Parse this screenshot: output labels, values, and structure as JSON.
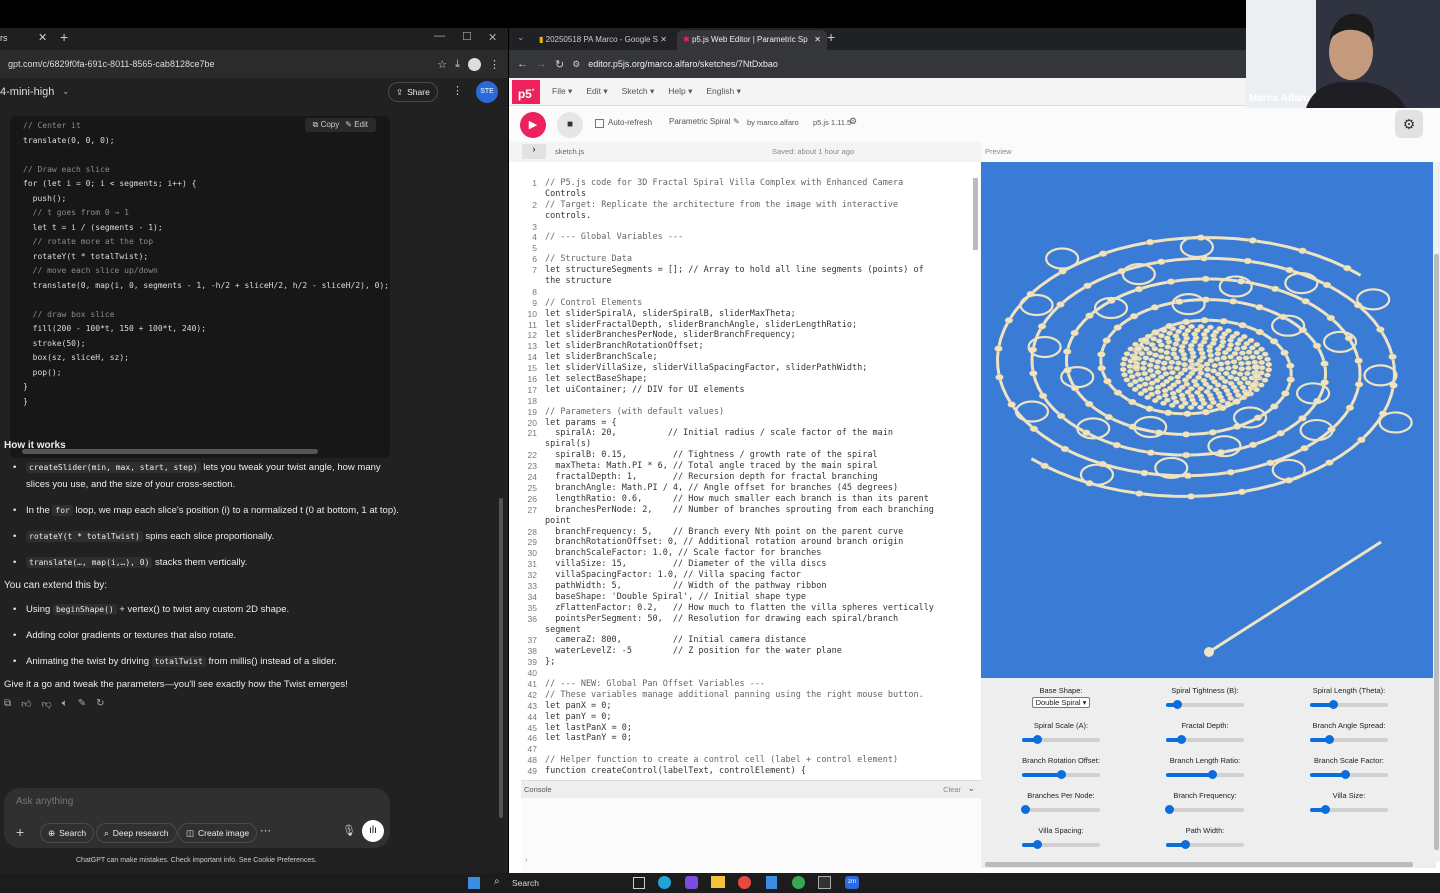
{
  "left": {
    "tab_title": "rs",
    "url": "gpt.com/c/6829f0fa-691c-8011-8565-cab8128ce7be",
    "model": "4-mini-high",
    "share_label": "Share",
    "avatar_text": "STE",
    "copy_label": "Copy",
    "edit_label": "Edit",
    "code_lines": [
      "// Center it",
      "translate(0, 0, 0);",
      "",
      "// Draw each slice",
      "for (let i = 0; i < segments; i++) {",
      "  push();",
      "  // t goes from 0 → 1",
      "  let t = i / (segments - 1);",
      "  // rotate more at the top",
      "  rotateY(t * totalTwist);",
      "  // move each slice up/down",
      "  translate(0, map(i, 0, segments - 1, -h/2 + sliceH/2, h/2 - sliceH/2), 0);",
      "",
      "  // draw box slice",
      "  fill(200 - 100*t, 150 + 100*t, 240);",
      "  stroke(50);",
      "  box(sz, sliceH, sz);",
      "  pop();",
      "}",
      "}"
    ],
    "how_heading": "How it works",
    "how_bullets": [
      {
        "code": "createSlider(min, max, start, step)",
        "text": " lets you tweak your twist angle, how many slices you use, and the size of your cross-section."
      },
      {
        "pre": "In the ",
        "code": "for",
        "text": " loop, we map each slice's position (i) to a normalized t (0 at bottom, 1 at top)."
      },
      {
        "code": "rotateY(t * totalTwist)",
        "text": " spins each slice proportionally."
      },
      {
        "code": "translate(…, map(i,…), 0)",
        "text": " stacks them vertically."
      }
    ],
    "extend_heading": "You can extend this by:",
    "extend_bullets": [
      {
        "pre": "Using ",
        "code": "beginShape()",
        "text": " + vertex() to twist any custom 2D shape."
      },
      {
        "pre": "",
        "code": "",
        "text": "Adding color gradients or textures that also rotate."
      },
      {
        "pre": "Animating the twist by driving ",
        "code": "totalTwist",
        "text": " from millis() instead of a slider."
      }
    ],
    "closing": "Give it a go and tweak the parameters—you'll see exactly how the Twist emerges!",
    "composer_placeholder": "Ask anything",
    "composer_buttons": [
      "Search",
      "Deep research",
      "Create image"
    ],
    "disclaimer": "ChatGPT can make mistakes. Check important info. See Cookie Preferences."
  },
  "right": {
    "tabs": [
      "20250518 PA Marco - Google S",
      "p5.js Web Editor | Parametric Sp"
    ],
    "url": "editor.p5js.org/marco.alfaro/sketches/7NtDxbao",
    "menu": [
      "File",
      "Edit",
      "Sketch",
      "Help",
      "English"
    ],
    "auto_refresh": "Auto-refresh",
    "sketch_name": "Parametric Spiral",
    "by": "by marco.alfaro",
    "version": "p5.js 1.11.5",
    "file_name": "sketch.js",
    "saved": "Saved: about 1 hour ago",
    "preview_label": "Preview",
    "console_label": "Console",
    "clear_label": "Clear",
    "code": [
      [
        "1",
        "// P5.js code for 3D Fractal Spiral Villa Complex with Enhanced Camera"
      ],
      [
        "",
        "Controls"
      ],
      [
        "2",
        "// Target: Replicate the architecture from the image with interactive"
      ],
      [
        "",
        "controls."
      ],
      [
        "3",
        ""
      ],
      [
        "4",
        "// --- Global Variables ---"
      ],
      [
        "5",
        ""
      ],
      [
        "6",
        "// Structure Data"
      ],
      [
        "7",
        "let structureSegments = []; // Array to hold all line segments (points) of"
      ],
      [
        "",
        "the structure"
      ],
      [
        "8",
        ""
      ],
      [
        "9",
        "// Control Elements"
      ],
      [
        "10",
        "let sliderSpiralA, sliderSpiralB, sliderMaxTheta;"
      ],
      [
        "11",
        "let sliderFractalDepth, sliderBranchAngle, sliderLengthRatio;"
      ],
      [
        "12",
        "let sliderBranchesPerNode, sliderBranchFrequency;"
      ],
      [
        "13",
        "let sliderBranchRotationOffset;"
      ],
      [
        "14",
        "let sliderBranchScale;"
      ],
      [
        "15",
        "let sliderVillaSize, sliderVillaSpacingFactor, sliderPathWidth;"
      ],
      [
        "16",
        "let selectBaseShape;"
      ],
      [
        "17",
        "let uiContainer; // DIV for UI elements"
      ],
      [
        "18",
        ""
      ],
      [
        "19",
        "// Parameters (with default values)"
      ],
      [
        "20",
        "let params = {"
      ],
      [
        "21",
        "  spiralA: 20,          // Initial radius / scale factor of the main"
      ],
      [
        "",
        "spiral(s)"
      ],
      [
        "22",
        "  spiralB: 0.15,         // Tightness / growth rate of the spiral"
      ],
      [
        "23",
        "  maxTheta: Math.PI * 6, // Total angle traced by the main spiral"
      ],
      [
        "24",
        "  fractalDepth: 1,       // Recursion depth for fractal branching"
      ],
      [
        "25",
        "  branchAngle: Math.PI / 4, // Angle offset for branches (45 degrees)"
      ],
      [
        "26",
        "  lengthRatio: 0.6,      // How much smaller each branch is than its parent"
      ],
      [
        "27",
        "  branchesPerNode: 2,    // Number of branches sprouting from each branching"
      ],
      [
        "",
        "point"
      ],
      [
        "28",
        "  branchFrequency: 5,    // Branch every Nth point on the parent curve"
      ],
      [
        "29",
        "  branchRotationOffset: 0, // Additional rotation around branch origin"
      ],
      [
        "30",
        "  branchScaleFactor: 1.0, // Scale factor for branches"
      ],
      [
        "31",
        "  villaSize: 15,         // Diameter of the villa discs"
      ],
      [
        "32",
        "  villaSpacingFactor: 1.0, // Villa spacing factor"
      ],
      [
        "33",
        "  pathWidth: 5,          // Width of the pathway ribbon"
      ],
      [
        "34",
        "  baseShape: 'Double Spiral', // Initial shape type"
      ],
      [
        "35",
        "  zFlattenFactor: 0.2,   // How much to flatten the villa spheres vertically"
      ],
      [
        "36",
        "  pointsPerSegment: 50,  // Resolution for drawing each spiral/branch"
      ],
      [
        "",
        "segment"
      ],
      [
        "37",
        "  cameraZ: 800,          // Initial camera distance"
      ],
      [
        "38",
        "  waterLevelZ: -5        // Z position for the water plane"
      ],
      [
        "39",
        "};"
      ],
      [
        "40",
        ""
      ],
      [
        "41",
        "// --- NEW: Global Pan Offset Variables ---"
      ],
      [
        "42",
        "// These variables manage additional panning using the right mouse button."
      ],
      [
        "43",
        "let panX = 0;"
      ],
      [
        "44",
        "let panY = 0;"
      ],
      [
        "45",
        "let lastPanX = 0;"
      ],
      [
        "46",
        "let lastPanY = 0;"
      ],
      [
        "47",
        ""
      ],
      [
        "48",
        "// Helper function to create a control cell (label + control element)"
      ],
      [
        "49",
        "function createControl(labelText, controlElement) {"
      ]
    ],
    "controls": [
      {
        "label": "Base Shape:",
        "select": "Double Spiral"
      },
      {
        "label": "Spiral Tightness (B):",
        "value": 0.15
      },
      {
        "label": "Spiral Length (Theta):",
        "value": 0.3
      },
      {
        "label": "Spiral Scale (A):",
        "value": 0.2
      },
      {
        "label": "Fractal Depth:",
        "value": 0.2
      },
      {
        "label": "Branch Angle Spread:",
        "value": 0.25
      },
      {
        "label": "Branch Rotation Offset:",
        "value": 0.5
      },
      {
        "label": "Branch Length Ratio:",
        "value": 0.6
      },
      {
        "label": "Branch Scale Factor:",
        "value": 0.45
      },
      {
        "label": "Branches Per Node:",
        "value": 0.05
      },
      {
        "label": "Branch Frequency:",
        "value": 0.05
      },
      {
        "label": "Villa Size:",
        "value": 0.2
      },
      {
        "label": "Villa Spacing:",
        "value": 0.2
      },
      {
        "label": "Path Width:",
        "value": 0.25
      }
    ]
  },
  "video": {
    "name": "Marco Alfaro"
  },
  "taskbar": {
    "search": "Search"
  },
  "colors": {
    "p5_pink": "#ed225d",
    "canvas_blue": "#3a7bd5",
    "slider_blue": "#0a6dd9",
    "villa": "#efe4c2"
  }
}
